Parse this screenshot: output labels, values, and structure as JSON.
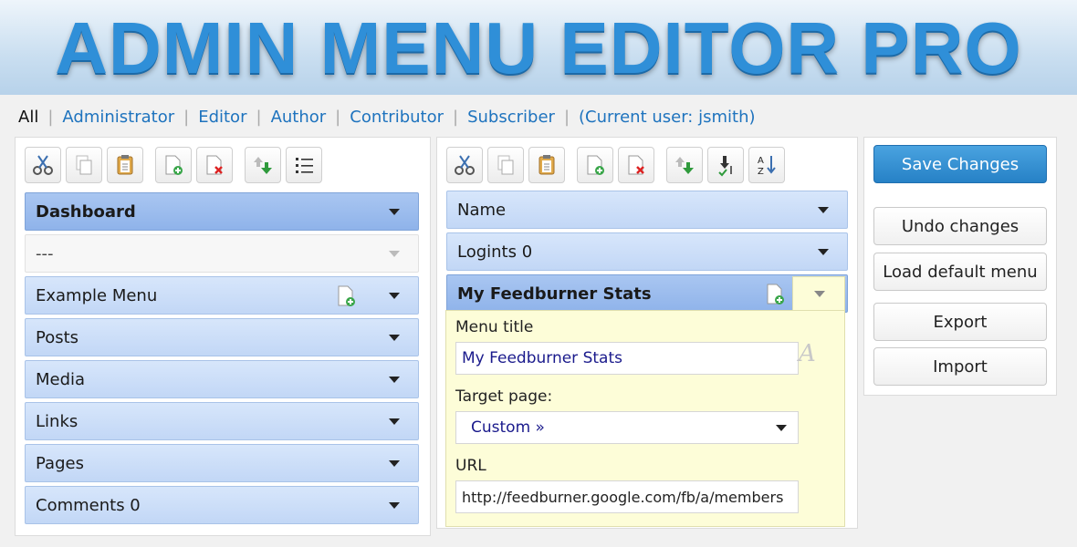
{
  "banner": {
    "title": "ADMIN MENU EDITOR PRO"
  },
  "roles": {
    "items": [
      "All",
      "Administrator",
      "Editor",
      "Author",
      "Contributor",
      "Subscriber",
      "(Current user: jsmith)"
    ]
  },
  "left_panel": {
    "toolbar": [
      "cut-icon",
      "copy-icon",
      "paste-icon",
      "new-item-icon",
      "delete-icon",
      "move-up-icon",
      "list-icon"
    ],
    "items": [
      {
        "label": "Dashboard",
        "selected": true
      },
      {
        "label": "---"
      },
      {
        "label": "Example Menu",
        "has_new_icon": true
      },
      {
        "label": "Posts"
      },
      {
        "label": "Media"
      },
      {
        "label": "Links"
      },
      {
        "label": "Pages"
      },
      {
        "label": "Comments 0"
      }
    ]
  },
  "middle_panel": {
    "toolbar": [
      "cut-icon",
      "copy-icon",
      "paste-icon",
      "new-item-icon",
      "delete-icon",
      "move-up-icon",
      "move-down-icon",
      "sort-az-icon"
    ],
    "items": [
      {
        "label": "Name"
      },
      {
        "label": "Logints 0"
      },
      {
        "label": "My Feedburner Stats",
        "selected": true
      }
    ],
    "editor": {
      "menu_title_label": "Menu title",
      "menu_title_value": "My Feedburner Stats",
      "target_page_label": "Target page:",
      "target_page_value": "Custom »",
      "url_label": "URL",
      "url_value": "http://feedburner.google.com/fb/a/members"
    }
  },
  "right_panel": {
    "save": "Save Changes",
    "undo": "Undo changes",
    "load_default": "Load default menu",
    "export": "Export",
    "import": "Import"
  },
  "colors": {
    "accent": "#2681c6",
    "item_bg": "#c2d7f6",
    "selected_bg": "#8fb3ea",
    "editor_bg": "#fdfdd8"
  }
}
